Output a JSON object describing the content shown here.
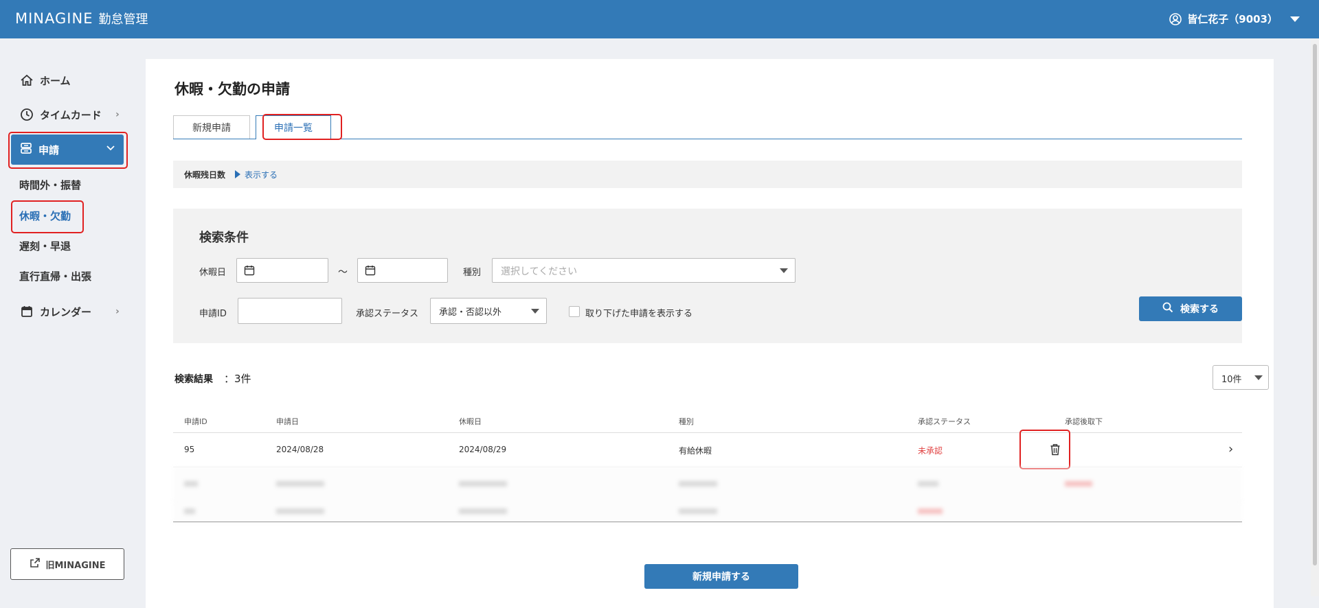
{
  "header": {
    "brand": "MINAGINE",
    "brand_sub": "勤怠管理",
    "user": "皆仁花子（9003）"
  },
  "sidebar": {
    "items": [
      {
        "label": "ホーム",
        "icon": "home-icon"
      },
      {
        "label": "タイムカード",
        "icon": "clock-icon"
      },
      {
        "label": "申請",
        "icon": "inbox-icon"
      },
      {
        "label": "カレンダー",
        "icon": "calendar-icon"
      }
    ],
    "sub_items": [
      "時間外・振替",
      "休暇・欠勤",
      "遅刻・早退",
      "直行直帰・出張"
    ],
    "old_link": "旧MINAGINE"
  },
  "page": {
    "title": "休暇・欠勤の申請",
    "tabs": [
      "新規申請",
      "申請一覧"
    ],
    "remaining_label": "休暇残日数",
    "remaining_link": "表示する"
  },
  "search": {
    "title": "検索条件",
    "date_label": "休暇日",
    "tilde": "～",
    "type_label": "種別",
    "type_placeholder": "選択してください",
    "id_label": "申請ID",
    "status_label": "承認ステータス",
    "status_value": "承認・否認以外",
    "withdrawn_label": "取り下げた申請を表示する",
    "search_button": "検索する"
  },
  "results": {
    "label": "検索結果",
    "count": "：3件",
    "per_page": "10件",
    "columns": [
      "申請ID",
      "申請日",
      "休暇日",
      "種別",
      "承認ステータス",
      "承認後取下"
    ],
    "rows": [
      {
        "id": "95",
        "applied": "2024/08/28",
        "leave_date": "2024/08/29",
        "type": "有給休暇",
        "status": "未承認",
        "withdraw": ""
      }
    ]
  },
  "new_button": "新規申請する",
  "colors": {
    "brand": "#337ab7",
    "highlight": "#e02020",
    "unapproved": "#e04040"
  }
}
